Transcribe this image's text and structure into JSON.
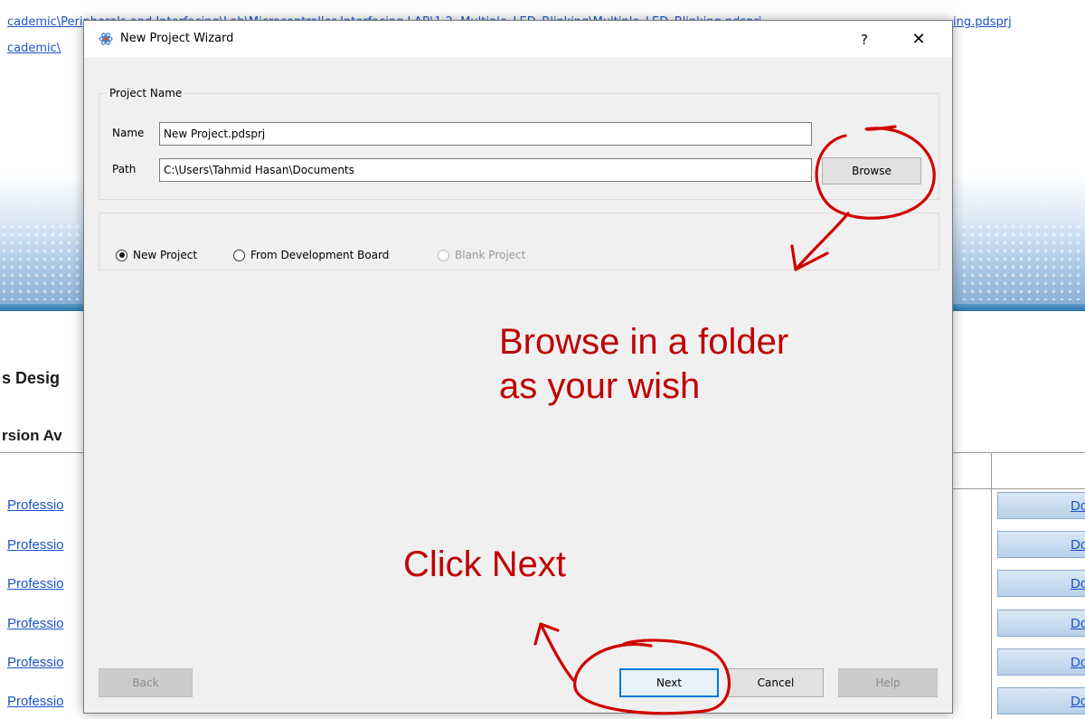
{
  "background": {
    "link_1": "cademic\\Peripherals and Interfacing\\Lab\\Microcontroller Interfacing LAB\\1.2. Multiple_LED_Blinking\\Multiple_LED_Blinking.pdsprj",
    "link_2": "cademic\\",
    "link_right": "ing.pdsprj",
    "heading_1": "s Desig",
    "heading_2": "rsion Av",
    "rows": [
      "Professio",
      "Professio",
      "Professio",
      "Professio",
      "Professio",
      "Professio"
    ],
    "download_label": "Dov"
  },
  "dialog": {
    "title": "New Project Wizard",
    "help_label": "?",
    "close_label": "✕",
    "project_name_group": {
      "title": "Project Name",
      "name_label": "Name",
      "name_value": "New Project.pdsprj",
      "path_label": "Path",
      "path_value": "C:\\Users\\Tahmid Hasan\\Documents",
      "browse_label": "Browse"
    },
    "project_type": {
      "options": [
        {
          "label": "New Project",
          "checked": true,
          "enabled": true
        },
        {
          "label": "From Development Board",
          "checked": false,
          "enabled": true
        },
        {
          "label": "Blank Project",
          "checked": false,
          "enabled": false
        }
      ]
    },
    "footer": {
      "back_label": "Back",
      "next_label": "Next",
      "cancel_label": "Cancel",
      "help_label": "Help"
    }
  },
  "annotations": {
    "browse_line_1": "Browse in a folder",
    "browse_line_2": "as your wish",
    "next": "Click Next",
    "color": "#c00000"
  },
  "colors": {
    "link": "#1a53c9",
    "dialog_bg": "#f0f0f0",
    "default_button_border": "#0078d7"
  }
}
